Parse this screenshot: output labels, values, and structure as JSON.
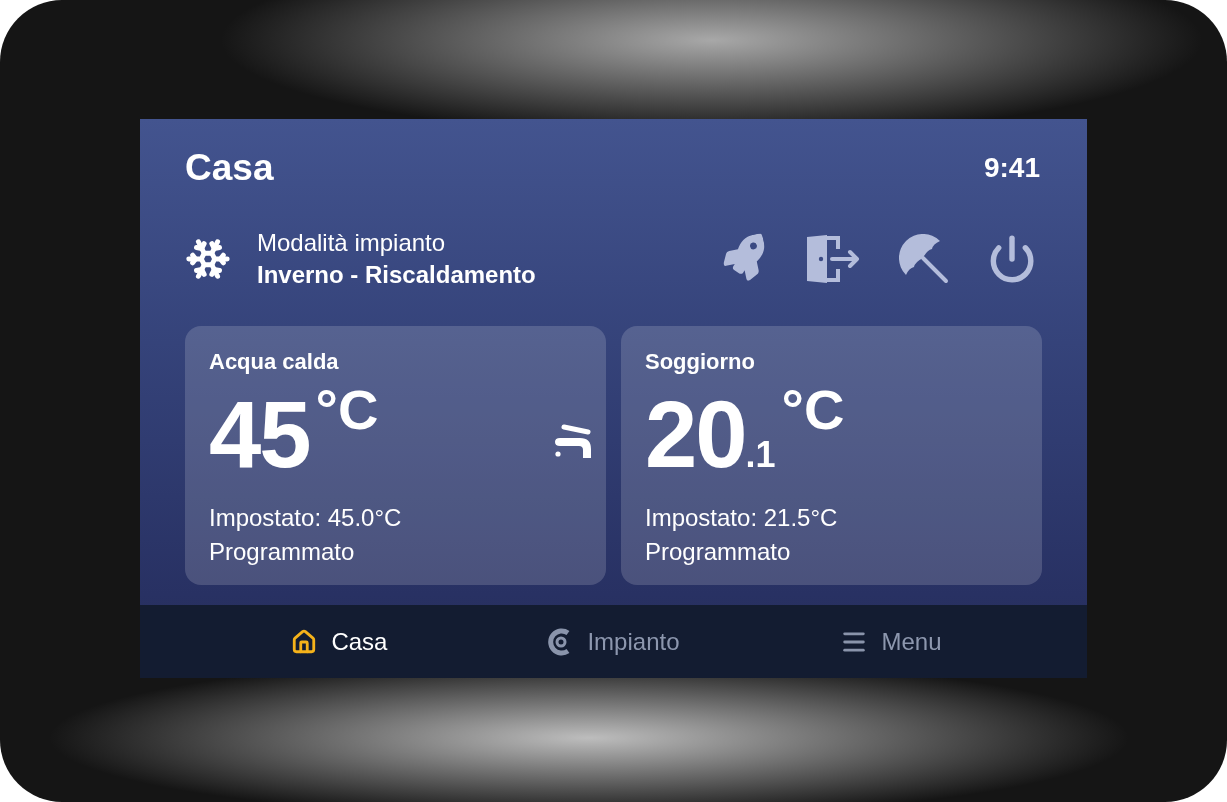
{
  "header": {
    "title": "Casa",
    "time": "9:41"
  },
  "mode": {
    "label": "Modalità impianto",
    "value": "Inverno - Riscaldamento"
  },
  "cards": [
    {
      "kind": "water",
      "title": "Acqua calda",
      "temperature": "45",
      "unit": "°C",
      "setpoint": "Impostato: 45.0°C",
      "status": "Programmato"
    },
    {
      "kind": "room",
      "title": "Soggiorno",
      "temperature": "20",
      "decimal": ".1",
      "unit": "°C",
      "setpoint": "Impostato: 21.5°C",
      "status": "Programmato"
    }
  ],
  "nav": [
    {
      "kind": "home",
      "label": "Casa",
      "selected": true
    },
    {
      "kind": "system",
      "label": "Impianto",
      "selected": false
    },
    {
      "kind": "menu",
      "label": "Menu",
      "selected": false
    }
  ]
}
